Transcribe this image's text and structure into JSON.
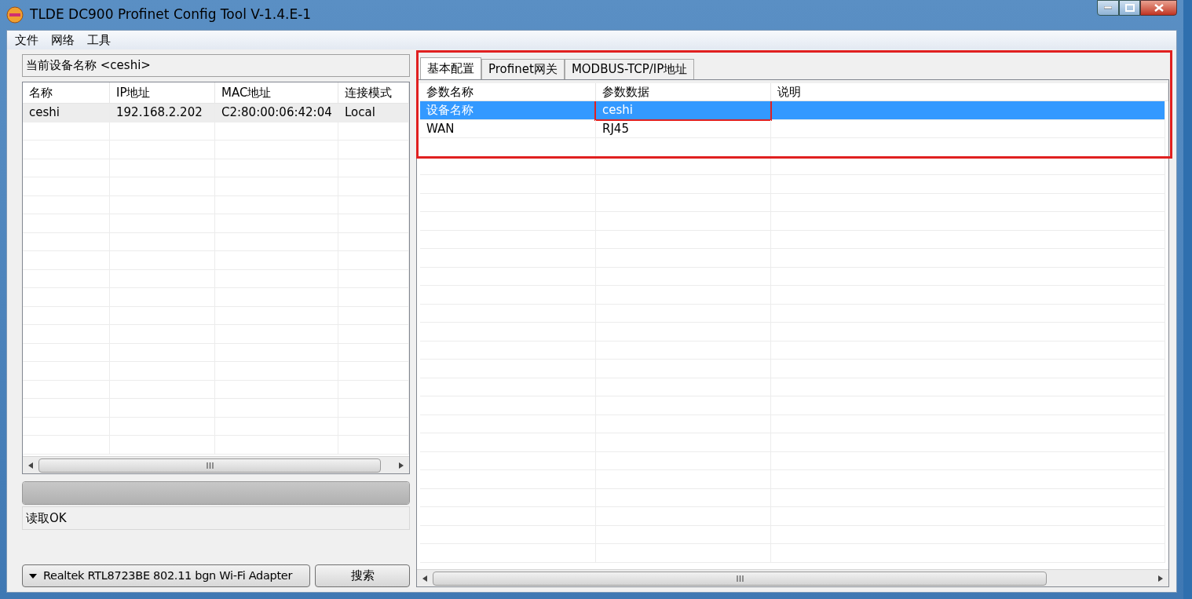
{
  "window": {
    "title": "TLDE DC900 Profinet Config Tool V-1.4.E-1"
  },
  "menu": [
    "文件",
    "网络",
    "工具"
  ],
  "current_device": "当前设备名称 <ceshi>",
  "device_table": {
    "columns": [
      "名称",
      "IP地址",
      "MAC地址",
      "连接模式"
    ],
    "rows": [
      {
        "cells": [
          "ceshi",
          "192.168.2.202",
          "C2:80:00:06:42:04",
          "Local"
        ],
        "selected": false
      }
    ]
  },
  "progress": {
    "level": 1
  },
  "status_text": "读取OK",
  "adapter": {
    "value": "Realtek RTL8723BE 802.11 bgn Wi-Fi Adapter"
  },
  "search_button": "搜索",
  "tabs": [
    {
      "label": "基本配置",
      "selected": true
    },
    {
      "label": "Profinet网关",
      "selected": false
    },
    {
      "label": "MODBUS-TCP/IP地址",
      "selected": false
    }
  ],
  "param_table": {
    "columns": [
      "参数名称",
      "参数数据",
      "说明"
    ],
    "rows": [
      {
        "cells": [
          "设备名称",
          "ceshi"
        ],
        "selected": true
      },
      {
        "cells": [
          "WAN",
          "RJ45"
        ],
        "selected": false
      }
    ]
  }
}
